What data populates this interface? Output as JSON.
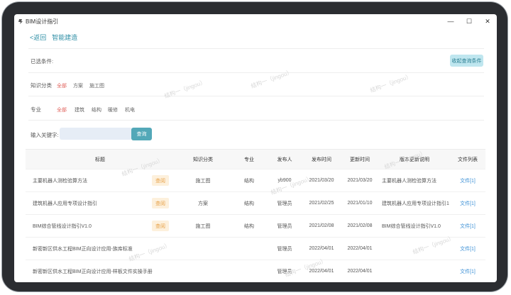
{
  "window": {
    "title": "BIM设计指引",
    "controls": {
      "minimize": "—",
      "maximize": "☐",
      "close": "✕"
    }
  },
  "nav": {
    "back_label": "<返回",
    "page_title": "智能建造"
  },
  "filters": {
    "selected_label": "已选条件:",
    "collapse_button": "收起查询条件",
    "category": {
      "label": "知识分类",
      "options": [
        "全部",
        "方案",
        "施工图"
      ],
      "active": "全部"
    },
    "major": {
      "label": "专业",
      "options": [
        "全部",
        "建筑",
        "结构",
        "暖修",
        "机电"
      ],
      "active": "全部"
    },
    "keyword": {
      "label": "输入关键字:",
      "value": "",
      "button": "查询"
    }
  },
  "table": {
    "headers": [
      "标题",
      "知识分类",
      "专业",
      "发布人",
      "发布时间",
      "更新时间",
      "版本更新说明",
      "文件列表"
    ],
    "rows": [
      {
        "title": "主要机器人测检验算方法",
        "tag": "查阅",
        "category": "施工图",
        "major": "结构",
        "publisher": "yb900",
        "published": "2021/03/20",
        "updated": "2021/03/20",
        "note": "主要机器人测检验算方法",
        "files": "文件[1]"
      },
      {
        "title": "建筑机器人应用专项设计指引",
        "tag": "查阅",
        "category": "方案",
        "major": "结构",
        "publisher": "管理员",
        "published": "2021/02/25",
        "updated": "2021/01/10",
        "note": "建筑机器人应用专项设计指引1",
        "files": "文件[1]"
      },
      {
        "title": "BIM综合管线设计指引V1.0",
        "tag": "查阅",
        "category": "施工图",
        "major": "结构",
        "publisher": "管理员",
        "published": "2021/02/08",
        "updated": "2021/02/08",
        "note": "BIM综合管线设计指引V1.0",
        "files": "文件[1]"
      },
      {
        "title": "新密新区供水工程BIM正向设计应用-族库标准",
        "tag": "",
        "category": "",
        "major": "",
        "publisher": "管理员",
        "published": "2022/04/01",
        "updated": "2022/04/01",
        "note": "",
        "files": "文件[1]"
      },
      {
        "title": "新密新区供水工程BIM正向设计应用-样板文件实操手册",
        "tag": "",
        "category": "",
        "major": "",
        "publisher": "管理员",
        "published": "2022/04/01",
        "updated": "2022/04/01",
        "note": "",
        "files": "文件[1]"
      }
    ]
  },
  "watermark": "结构一（jingou）",
  "colors": {
    "accent": "#2f8fa6",
    "active_option": "#e0605a",
    "tag_bg": "#fdf0dc",
    "tag_text": "#e7a24a",
    "link": "#3a8fd6"
  }
}
